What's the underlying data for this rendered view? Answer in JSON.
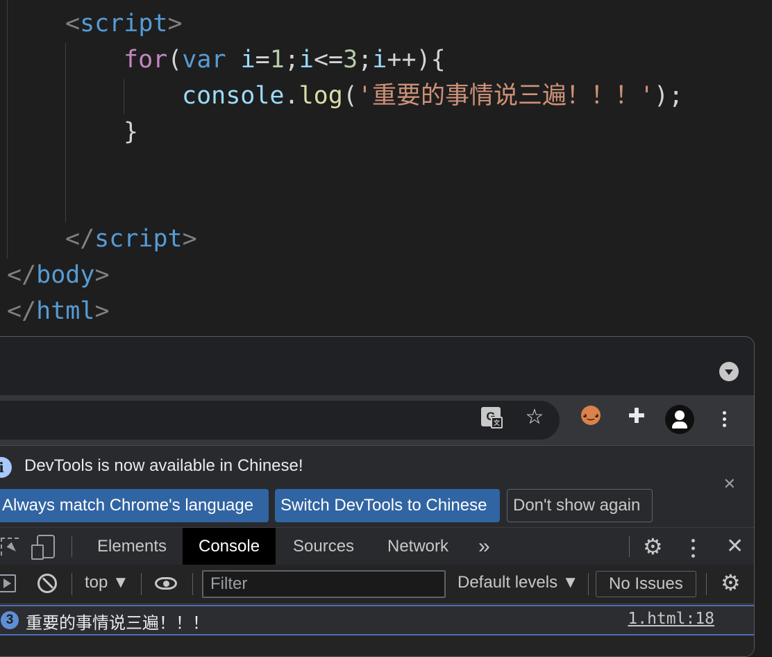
{
  "editor": {
    "lines": [
      {
        "tokens": [
          {
            "t": "<",
            "c": "tk-punc"
          },
          {
            "t": "script",
            "c": "tk-tag"
          },
          {
            "t": ">",
            "c": "tk-punc"
          }
        ]
      },
      {
        "tokens": [
          {
            "t": "for",
            "c": "tk-kw"
          },
          {
            "t": "(",
            "c": "tk-op"
          },
          {
            "t": "var",
            "c": "tk-var"
          },
          {
            "t": " ",
            "c": "tk-op"
          },
          {
            "t": "i",
            "c": "tk-id"
          },
          {
            "t": "=",
            "c": "tk-op"
          },
          {
            "t": "1",
            "c": "tk-num"
          },
          {
            "t": ";",
            "c": "tk-op"
          },
          {
            "t": "i",
            "c": "tk-id"
          },
          {
            "t": "<=",
            "c": "tk-op"
          },
          {
            "t": "3",
            "c": "tk-num"
          },
          {
            "t": ";",
            "c": "tk-op"
          },
          {
            "t": "i",
            "c": "tk-id"
          },
          {
            "t": "++){",
            "c": "tk-op"
          }
        ]
      },
      {
        "tokens": [
          {
            "t": "console",
            "c": "tk-obj"
          },
          {
            "t": ".",
            "c": "tk-op"
          },
          {
            "t": "log",
            "c": "tk-fn"
          },
          {
            "t": "(",
            "c": "tk-op"
          },
          {
            "t": "'重要的事情说三遍！！！'",
            "c": "tk-str"
          },
          {
            "t": ");",
            "c": "tk-op"
          }
        ]
      },
      {
        "tokens": [
          {
            "t": "}",
            "c": "tk-op"
          }
        ]
      },
      {
        "tokens": []
      },
      {
        "tokens": []
      },
      {
        "tokens": [
          {
            "t": "</",
            "c": "tk-punc"
          },
          {
            "t": "script",
            "c": "tk-tag"
          },
          {
            "t": ">",
            "c": "tk-punc"
          }
        ]
      },
      {
        "tokens": [
          {
            "t": "</",
            "c": "tk-punc"
          },
          {
            "t": "body",
            "c": "tk-tag"
          },
          {
            "t": ">",
            "c": "tk-punc"
          }
        ]
      },
      {
        "tokens": [
          {
            "t": "</",
            "c": "tk-punc"
          },
          {
            "t": "html",
            "c": "tk-tag"
          },
          {
            "t": ">",
            "c": "tk-punc"
          }
        ]
      }
    ]
  },
  "browser": {
    "toolbar_icons": [
      "translate-icon",
      "star-icon",
      "tampermonkey-icon",
      "extensions-icon",
      "profile-icon",
      "menu-icon"
    ]
  },
  "devtools": {
    "infobar": {
      "message": "DevTools is now available in Chinese!",
      "btn_match": "Always match Chrome's language",
      "btn_switch": "Switch DevTools to Chinese",
      "btn_dismiss": "Don't show again"
    },
    "tabs": {
      "elements": "Elements",
      "console": "Console",
      "sources": "Sources",
      "network": "Network",
      "more": "»"
    },
    "console_toolbar": {
      "context": "top ▼",
      "filter_placeholder": "Filter",
      "levels": "Default levels ▼",
      "issues": "No Issues"
    },
    "messages": [
      {
        "count": "3",
        "text": "重要的事情说三遍！！！",
        "source": "1.html:18"
      }
    ]
  }
}
